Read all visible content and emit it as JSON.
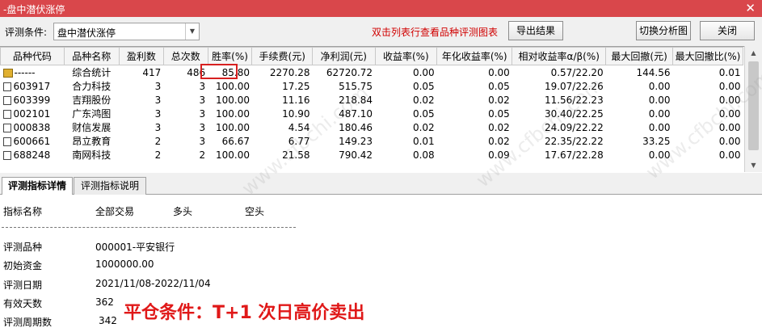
{
  "window": {
    "title": "-盘中潜伏涨停",
    "close_glyph": "✕"
  },
  "toolbar": {
    "condition_label": "评测条件:",
    "condition_value": "盘中潜伏涨停",
    "hint": "双击列表行查看品种评测图表",
    "export_label": "导出结果",
    "switch_label": "切换分析图",
    "close_label": "关闭"
  },
  "table": {
    "columns": [
      "品种代码",
      "品种名称",
      "盈利数",
      "总次数",
      "胜率(%)",
      "手续费(元)",
      "净利润(元)",
      "收益率(%)",
      "年化收益率(%)",
      "相对收益率α/β(%)",
      "最大回撤(元)",
      "最大回撤比(%)"
    ],
    "rows": [
      [
        "------",
        "综合统计",
        "417",
        "486",
        "85.80",
        "2270.28",
        "62720.72",
        "0.00",
        "0.00",
        "0.57/22.20",
        "144.56",
        "0.01"
      ],
      [
        "603917",
        "合力科技",
        "3",
        "3",
        "100.00",
        "17.25",
        "515.75",
        "0.05",
        "0.05",
        "19.07/22.26",
        "0.00",
        "0.00"
      ],
      [
        "603399",
        "吉翔股份",
        "3",
        "3",
        "100.00",
        "11.16",
        "218.84",
        "0.02",
        "0.02",
        "11.56/22.23",
        "0.00",
        "0.00"
      ],
      [
        "002101",
        "广东鸿图",
        "3",
        "3",
        "100.00",
        "10.90",
        "487.10",
        "0.05",
        "0.05",
        "30.40/22.25",
        "0.00",
        "0.00"
      ],
      [
        "000838",
        "财信发展",
        "3",
        "3",
        "100.00",
        "4.54",
        "180.46",
        "0.02",
        "0.02",
        "24.09/22.22",
        "0.00",
        "0.00"
      ],
      [
        "600661",
        "昂立教育",
        "2",
        "3",
        "66.67",
        "6.77",
        "149.23",
        "0.01",
        "0.02",
        "22.35/22.22",
        "33.25",
        "0.00"
      ],
      [
        "688248",
        "南网科技",
        "2",
        "2",
        "100.00",
        "21.58",
        "790.42",
        "0.08",
        "0.09",
        "17.67/22.28",
        "0.00",
        "0.00"
      ]
    ]
  },
  "tabs": [
    "评测指标详情",
    "评测指标说明"
  ],
  "detail": {
    "header": [
      "指标名称",
      "全部交易",
      "多头",
      "空头"
    ],
    "items": [
      {
        "label": "评测品种",
        "value": "000001-平安银行"
      },
      {
        "label": "初始资金",
        "value": "1000000.00"
      },
      {
        "label": "评测日期",
        "value": "2021/11/08-2022/11/04"
      },
      {
        "label": "有效天数",
        "value": "362"
      },
      {
        "label": "评测周期数",
        "value": "342"
      }
    ],
    "banner": "平仓条件：T+1  次日高价卖出"
  },
  "watermark": "www.cfbchi.com",
  "colors": {
    "titlebar": "#d9474b",
    "highlight_box": "#d72020",
    "hint": "#d00000",
    "banner": "#e01818"
  }
}
